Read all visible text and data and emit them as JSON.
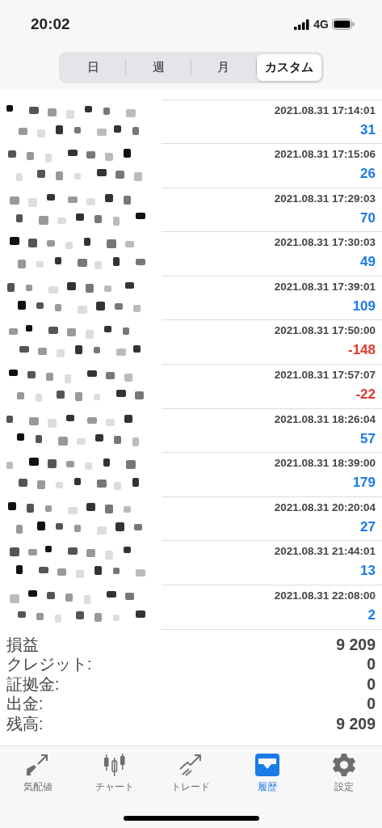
{
  "status_bar": {
    "time": "20:02",
    "network": "4G"
  },
  "segments": [
    {
      "label": "日",
      "selected": false
    },
    {
      "label": "週",
      "selected": false
    },
    {
      "label": "月",
      "selected": false
    },
    {
      "label": "カスタム",
      "selected": true
    }
  ],
  "deals": [
    {
      "time": "2021.08.31 17:14:01",
      "profit": "31",
      "color": "#1a7ae6"
    },
    {
      "time": "2021.08.31 17:15:06",
      "profit": "26",
      "color": "#1a7ae6"
    },
    {
      "time": "2021.08.31 17:29:03",
      "profit": "70",
      "color": "#1a7ae6"
    },
    {
      "time": "2021.08.31 17:30:03",
      "profit": "49",
      "color": "#1a7ae6"
    },
    {
      "time": "2021.08.31 17:39:01",
      "profit": "109",
      "color": "#1a7ae6"
    },
    {
      "time": "2021.08.31 17:50:00",
      "profit": "-148",
      "color": "#e0392b"
    },
    {
      "time": "2021.08.31 17:57:07",
      "profit": "-22",
      "color": "#e0392b"
    },
    {
      "time": "2021.08.31 18:26:04",
      "profit": "57",
      "color": "#1a7ae6"
    },
    {
      "time": "2021.08.31 18:39:00",
      "profit": "179",
      "color": "#1a7ae6"
    },
    {
      "time": "2021.08.31 20:20:04",
      "profit": "27",
      "color": "#1a7ae6"
    },
    {
      "time": "2021.08.31 21:44:01",
      "profit": "13",
      "color": "#1a7ae6"
    },
    {
      "time": "2021.08.31 22:08:00",
      "profit": "2",
      "color": "#1a7ae6"
    }
  ],
  "summary": [
    {
      "label": "損益",
      "value": "9 209"
    },
    {
      "label": "クレジット:",
      "value": "0"
    },
    {
      "label": "証拠金:",
      "value": "0"
    },
    {
      "label": "出金:",
      "value": "0"
    },
    {
      "label": "残高:",
      "value": "9 209"
    }
  ],
  "tab_bar": [
    {
      "label": "気配値",
      "kind": "quotes",
      "selected": false
    },
    {
      "label": "チャート",
      "kind": "chart",
      "selected": false
    },
    {
      "label": "トレード",
      "kind": "trade",
      "selected": false
    },
    {
      "label": "履歴",
      "kind": "history",
      "selected": true
    },
    {
      "label": "設定",
      "kind": "settings",
      "selected": false
    }
  ]
}
